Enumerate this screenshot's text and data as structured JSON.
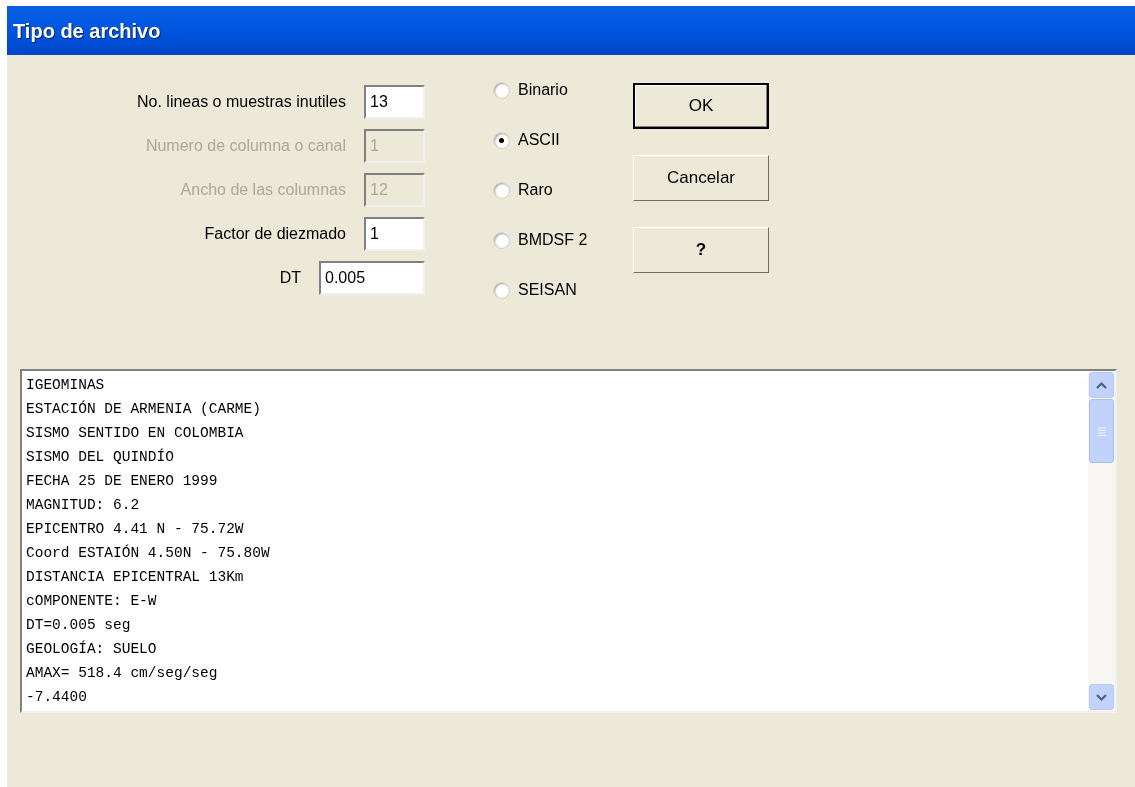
{
  "window": {
    "title": "Tipo de archivo"
  },
  "fields": [
    {
      "label": "No. lineas o muestras inutiles",
      "value": "13",
      "disabled": false,
      "kind": "short"
    },
    {
      "label": "Numero de columna o canal",
      "value": "1",
      "disabled": true,
      "kind": "short"
    },
    {
      "label": "Ancho de las columnas",
      "value": "12",
      "disabled": true,
      "kind": "short"
    },
    {
      "label": "Factor de diezmado",
      "value": "1",
      "disabled": false,
      "kind": "short"
    },
    {
      "label": "DT",
      "value": "0.005",
      "disabled": false,
      "kind": "wide"
    }
  ],
  "formats": [
    {
      "label": "Binario",
      "selected": false
    },
    {
      "label": "ASCII",
      "selected": true
    },
    {
      "label": "Raro",
      "selected": false
    },
    {
      "label": "BMDSF 2",
      "selected": false
    },
    {
      "label": "SEISAN",
      "selected": false
    }
  ],
  "buttons": [
    {
      "label": "OK",
      "default": true
    },
    {
      "label": "Cancelar",
      "default": false
    },
    {
      "label": "?",
      "default": false
    }
  ],
  "file_preview": {
    "lines": [
      "IGEOMINAS",
      "ESTACIÓN DE ARMENIA (CARME)",
      "SISMO SENTIDO EN COLOMBIA",
      "SISMO DEL QUINDÍO",
      "FECHA 25 DE ENERO 1999",
      "MAGNITUD: 6.2",
      "EPICENTRO 4.41 N - 75.72W",
      "Coord ESTAIÓN 4.50N - 75.80W",
      "DISTANCIA EPICENTRAL 13Km",
      "cOMPONENTE: E-W",
      "DT=0.005 seg",
      "GEOLOGÍA: SUELO",
      "AMAX= 518.4 cm/seg/seg",
      "-7.4400"
    ]
  }
}
